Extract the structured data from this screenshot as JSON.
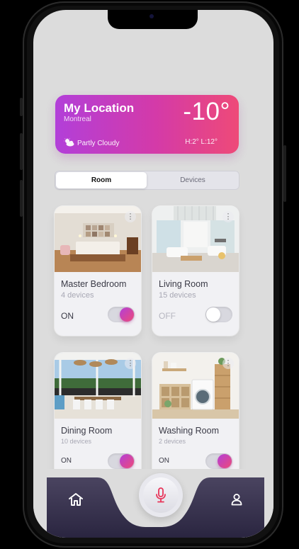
{
  "weather": {
    "title": "My Location",
    "city": "Montreal",
    "temperature": "-10°",
    "condition": "Partly Cloudy",
    "high_low": "H:2°  L:12°"
  },
  "tabs": [
    {
      "label": "Room",
      "selected": true
    },
    {
      "label": "Devices",
      "selected": false
    }
  ],
  "rooms": [
    {
      "name": "Master Bedroom",
      "devices": "4 devices",
      "state": "ON",
      "on": true
    },
    {
      "name": "Living Room",
      "devices": "15 devices",
      "state": "OFF",
      "on": false
    },
    {
      "name": "Dining Room",
      "devices": "10 devices",
      "state": "ON",
      "on": true
    },
    {
      "name": "Washing Room",
      "devices": "2 devices",
      "state": "ON",
      "on": true
    }
  ],
  "colors": {
    "accent_start": "#b23fd9",
    "accent_end": "#ee4a78",
    "nav_dark": "#2f2a44",
    "mic_red": "#e8355a"
  },
  "nav": {
    "icons": [
      "home-icon",
      "microphone-icon",
      "user-icon"
    ]
  }
}
